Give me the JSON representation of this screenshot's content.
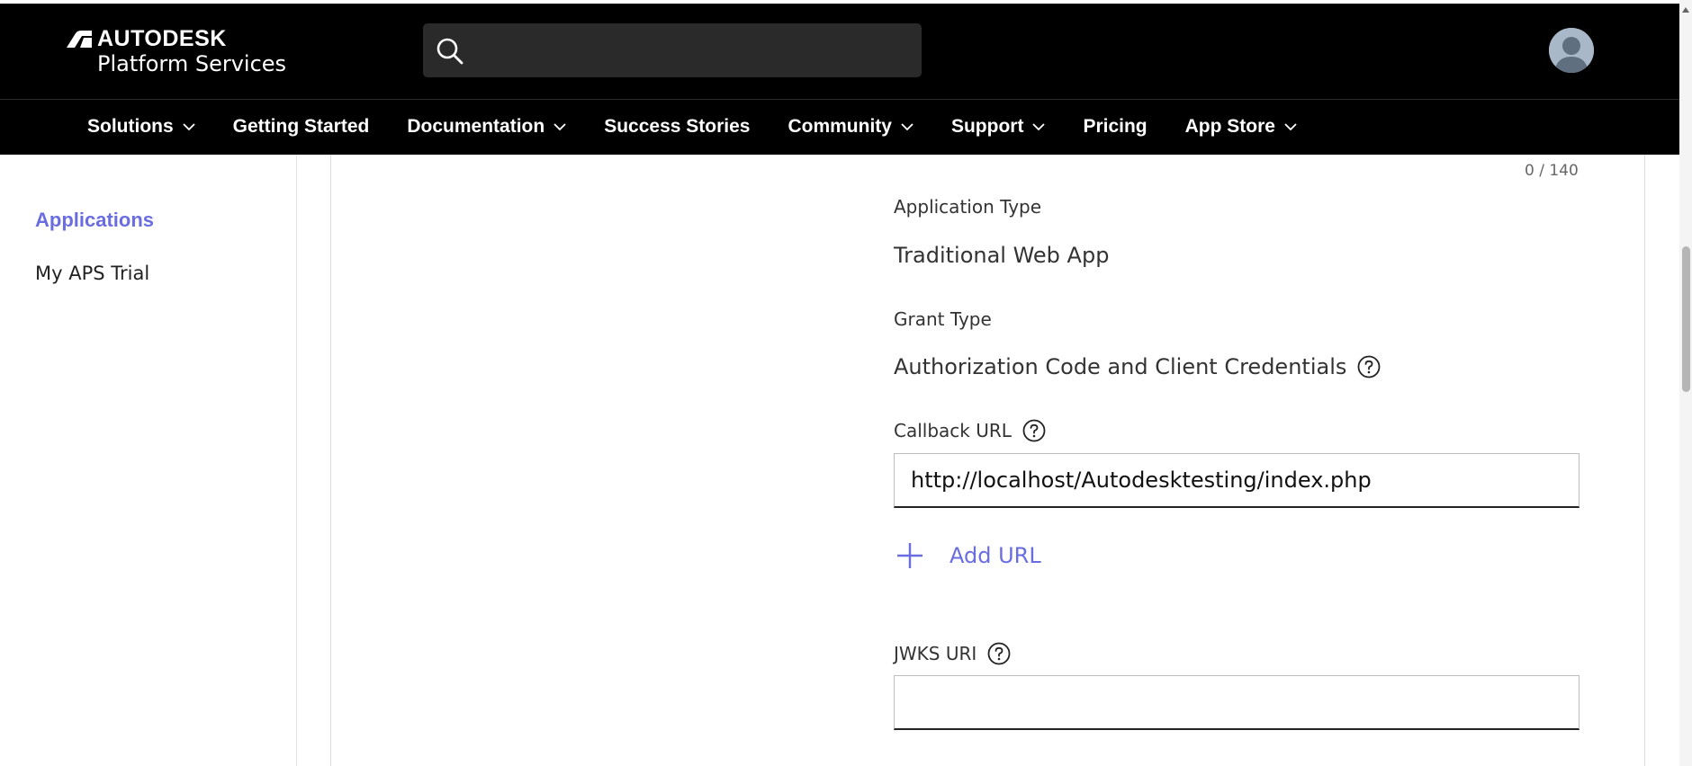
{
  "header": {
    "brand": "AUTODESK",
    "product": "Platform Services",
    "logo_icon": "autodesk-logo-icon",
    "search_icon": "search-icon",
    "search_placeholder": "",
    "avatar_icon": "user-avatar-icon"
  },
  "nav": {
    "items": [
      {
        "label": "Solutions",
        "has_dropdown": true
      },
      {
        "label": "Getting Started",
        "has_dropdown": false
      },
      {
        "label": "Documentation",
        "has_dropdown": true
      },
      {
        "label": "Success Stories",
        "has_dropdown": false
      },
      {
        "label": "Community",
        "has_dropdown": true
      },
      {
        "label": "Support",
        "has_dropdown": true
      },
      {
        "label": "Pricing",
        "has_dropdown": false
      },
      {
        "label": "App Store",
        "has_dropdown": true
      }
    ]
  },
  "sidebar": {
    "items": [
      {
        "label": "Applications",
        "active": true
      },
      {
        "label": "My APS Trial",
        "active": false
      }
    ]
  },
  "form": {
    "description_counter": "0 / 140",
    "application_type_label": "Application Type",
    "application_type_value": "Traditional Web App",
    "grant_type_label": "Grant Type",
    "grant_type_value": "Authorization Code and Client Credentials",
    "callback_url_label": "Callback URL",
    "callback_url_value": "http://localhost/Autodesktesting/index.php",
    "add_url_label": "Add URL",
    "jwks_uri_label": "JWKS URI",
    "jwks_uri_value": ""
  },
  "colors": {
    "accent": "#6a6de0",
    "header_bg": "#000000",
    "search_bg": "#2a2a2a"
  }
}
